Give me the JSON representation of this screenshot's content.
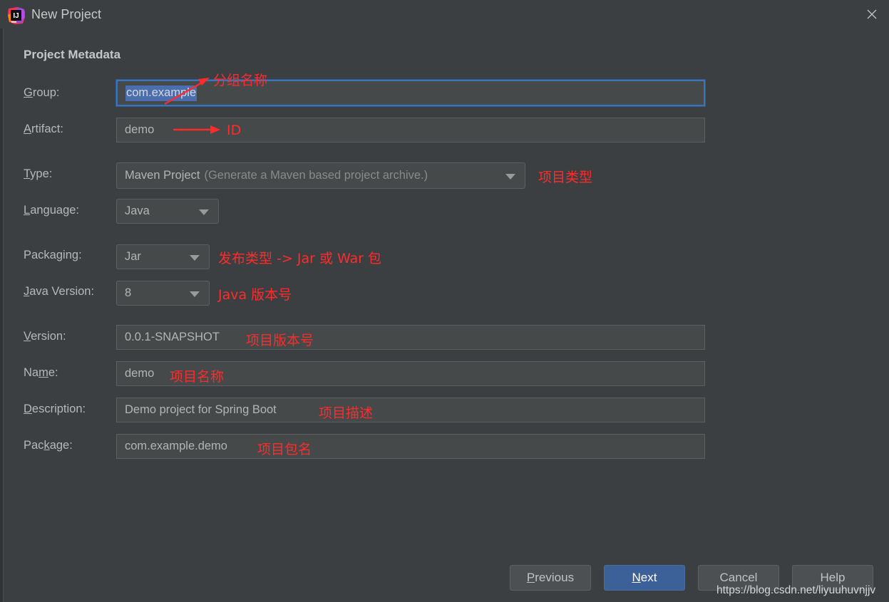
{
  "window": {
    "title": "New Project",
    "logo_text": "IJ",
    "close_label": "✕"
  },
  "section": {
    "heading": "Project Metadata"
  },
  "fields": {
    "group": {
      "label": "Group:",
      "mnemonic": "G",
      "label_rest": "roup:",
      "value": "com.example",
      "selected": true,
      "annotation": "分组名称"
    },
    "artifact": {
      "label": "Artifact:",
      "mnemonic": "A",
      "label_rest": "rtifact:",
      "value": "demo",
      "annotation": "ID"
    },
    "type": {
      "label": "Type:",
      "mnemonic": "T",
      "label_rest": "ype:",
      "value": "Maven Project",
      "hint": "(Generate a Maven based project archive.)",
      "annotation": "项目类型"
    },
    "language": {
      "label": "Language:",
      "mnemonic": "L",
      "label_rest": "anguage:",
      "value": "Java",
      "annotation": ""
    },
    "packaging": {
      "label": "Packaging:",
      "label_pre": "Packa",
      "mnemonic": "g",
      "label_rest": "ing:",
      "value": "Jar",
      "annotation": "发布类型 -> Jar 或 War 包"
    },
    "java_version": {
      "label": "Java Version:",
      "mnemonic": "J",
      "label_rest": "ava Version:",
      "value": "8",
      "annotation": "Java 版本号"
    },
    "version": {
      "label": "Version:",
      "mnemonic": "V",
      "label_rest": "ersion:",
      "value": "0.0.1-SNAPSHOT",
      "annotation": "项目版本号"
    },
    "name": {
      "label": "Name:",
      "label_pre": "Na",
      "mnemonic": "m",
      "label_rest": "e:",
      "value": "demo",
      "annotation": "项目名称"
    },
    "description": {
      "label": "Description:",
      "mnemonic": "D",
      "label_rest": "escription:",
      "value": "Demo project for Spring Boot",
      "annotation": "项目描述"
    },
    "package": {
      "label": "Package:",
      "label_pre": "Pac",
      "mnemonic": "k",
      "label_rest": "age:",
      "value": "com.example.demo",
      "annotation": "项目包名"
    }
  },
  "buttons": {
    "previous": {
      "pre": "",
      "mnemonic": "P",
      "rest": "revious",
      "label": "Previous"
    },
    "next": {
      "pre": "",
      "mnemonic": "N",
      "rest": "ext",
      "label": "Next"
    },
    "cancel": {
      "label": "Cancel"
    },
    "help": {
      "label": "Help"
    }
  },
  "watermark": "https://blog.csdn.net/liyuuhuvnjjv",
  "colors": {
    "dialog_bg": "#3c3f41",
    "field_bg": "#45494a",
    "focus_border": "#3d74b8",
    "selection": "#4b6eaf",
    "primary_button": "#3c6199",
    "annotation_red": "#ff2b2b"
  }
}
